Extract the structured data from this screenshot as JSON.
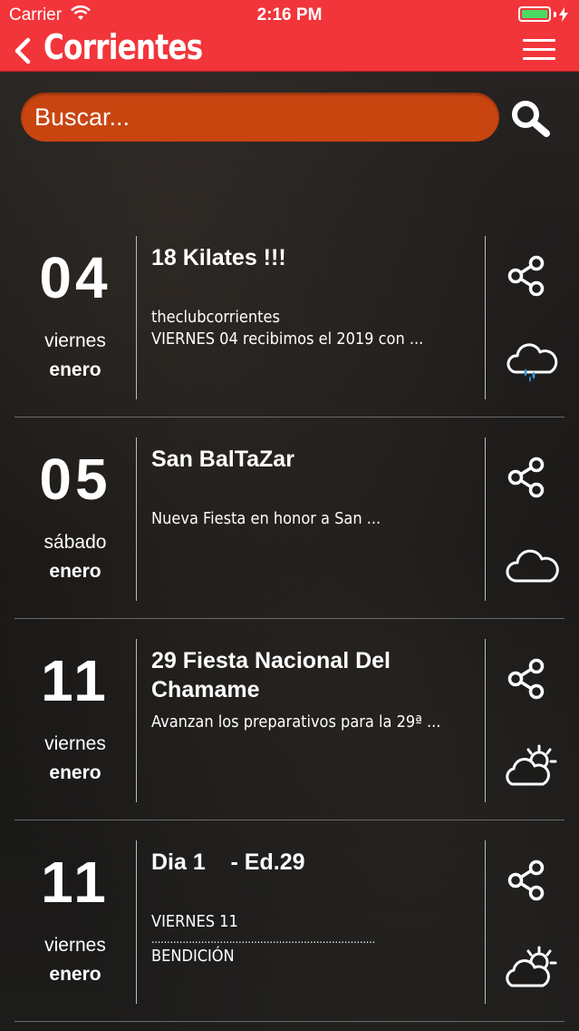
{
  "status_bar": {
    "carrier": "Carrier",
    "time": "2:16 PM"
  },
  "nav": {
    "title": "Corrientes"
  },
  "search": {
    "placeholder": "Buscar..."
  },
  "events": [
    {
      "day": "04",
      "weekday": "viernes",
      "month": "enero",
      "title": "18 Kilates !!!",
      "lines": [
        "theclubcorrientes",
        "VIERNES 04 recibimos el 2019 con ..."
      ],
      "weather": "rain-cloud-icon"
    },
    {
      "day": "05",
      "weekday": "sábado",
      "month": "enero",
      "title": "San BalTaZar",
      "lines": [
        "Nueva Fiesta en honor a San ..."
      ],
      "weather": "cloud-icon"
    },
    {
      "day": "11",
      "weekday": "viernes",
      "month": "enero",
      "title": "29 Fiesta Nacional Del Chamame",
      "lines": [
        "Avanzan los preparativos para la 29ª ..."
      ],
      "weather": "partly-sunny-icon"
    },
    {
      "day": "11",
      "weekday": "viernes",
      "month": "enero",
      "title": "Dia 1    - Ed.29",
      "lines": [
        "VIERNES 11",
        "........................................................................",
        "BENDICIÓN"
      ],
      "weather": "partly-sunny-icon"
    }
  ],
  "colors": {
    "accent": "#f2353a",
    "search_bg": "#c84510",
    "battery": "#4cd964"
  }
}
